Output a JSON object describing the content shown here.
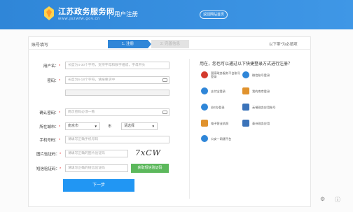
{
  "header": {
    "brand_title": "江苏政务服务网",
    "brand_url": "www.jszwfw.gov.cn",
    "page_name": "用户注册",
    "back_home_label": "返回网站首页"
  },
  "steps": {
    "card_title": "账号填写",
    "step1": "1. 注册",
    "step2": "2. 完善信息",
    "required_note": "以下带*为必填项"
  },
  "form": {
    "username": {
      "label": "用户名：",
      "placeholder": "长度为4-30个字符，支持字母和数字组成，字母开头"
    },
    "password": {
      "label": "密码：",
      "placeholder": "长度为6-18个字符，请按要求中"
    },
    "confirm_password": {
      "label": "确认密码：",
      "placeholder": "两次密码必须一致"
    },
    "region": {
      "label": "所在城市：",
      "city_value": "南京市",
      "district_label": "市",
      "district_value": "请选择"
    },
    "mobile": {
      "label": "手机号码：",
      "placeholder": "请填写正确手机号码"
    },
    "image_captcha": {
      "label": "图片验证码：",
      "placeholder": "请填写正确的图片验证码",
      "captcha_text": "7xCW"
    },
    "sms_code": {
      "label": "短信验证码：",
      "placeholder": "请填写正确的短信验证码",
      "button": "获取短信验证码"
    },
    "next_button": "下一步"
  },
  "quick_login": {
    "title": "用在，您也可以通过以下快捷登录方式进行注册？",
    "items": [
      {
        "label": "国家政务服务平台账号登录",
        "icon": "national-emblem-icon",
        "color": "#d33a2c"
      },
      {
        "label": "微信账号登录",
        "icon": "wechat-icon",
        "color": "#2f86d8"
      },
      {
        "label": "支付宝登录",
        "icon": "alipay-icon",
        "color": "#2f86d8"
      },
      {
        "label": "我的南京登录",
        "icon": "house-icon",
        "color": "#e0922d"
      },
      {
        "label": "苏E办登录",
        "icon": "sue-icon",
        "color": "#2f86d8"
      },
      {
        "label": "无锡政务应用账号",
        "icon": "wuxi-icon",
        "color": "#3b73b9"
      },
      {
        "label": "电子营业执照",
        "icon": "license-icon",
        "color": "#e0922d"
      },
      {
        "label": "泰州政务应用",
        "icon": "taizhou-icon",
        "color": "#3b73b9"
      },
      {
        "label": "公安一网通平台",
        "icon": "police-icon",
        "color": "#2f86d8"
      }
    ]
  }
}
